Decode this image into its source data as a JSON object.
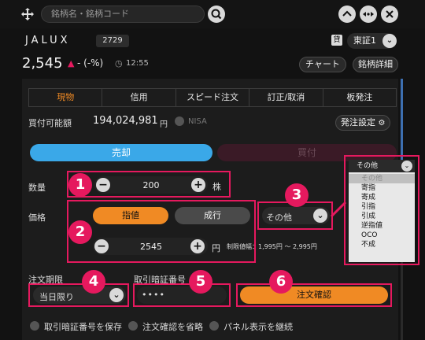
{
  "search": {
    "placeholder": "銘柄名・銘柄コード"
  },
  "stock": {
    "name": "JALUX",
    "code": "2729",
    "loan_badge": "貸",
    "market": "東証1",
    "price": "2,545",
    "change": "- (-%)",
    "time": "12:55",
    "chart_label": "チャート",
    "detail_label": "銘柄詳細"
  },
  "tabs": [
    "現物",
    "信用",
    "スピード注文",
    "訂正/取消",
    "板発注"
  ],
  "buying_power": {
    "label": "買付可能額",
    "value": "194,024,981",
    "unit": "円",
    "nisa": "NISA",
    "settings_label": "発注設定"
  },
  "sides": {
    "sell": "売却",
    "buy": "買付"
  },
  "quantity": {
    "label": "数量",
    "value": "200",
    "unit": "株"
  },
  "price_section": {
    "label": "価格",
    "limit": "指値",
    "market": "成行",
    "value": "2545",
    "unit": "円",
    "limit_range": "制限値幅：1,995円 〜 2,995円",
    "condition": "その他"
  },
  "condition_dropdown": {
    "selected": "その他",
    "options": [
      "その他",
      "寄指",
      "寄成",
      "引指",
      "引成",
      "逆指値",
      "OCO",
      "不成"
    ]
  },
  "expiry": {
    "label": "注文期限",
    "value": "当日限り"
  },
  "pin": {
    "label": "取引暗証番号",
    "value": "••••"
  },
  "confirm_label": "注文確認",
  "options": [
    "取引暗証番号を保存",
    "注文確認を省略",
    "パネル表示を継続"
  ],
  "markers": [
    "1",
    "2",
    "3",
    "4",
    "5",
    "6"
  ],
  "colors": {
    "accent": "#f08a24",
    "sell": "#3aa8e8",
    "highlight": "#e5195e"
  }
}
